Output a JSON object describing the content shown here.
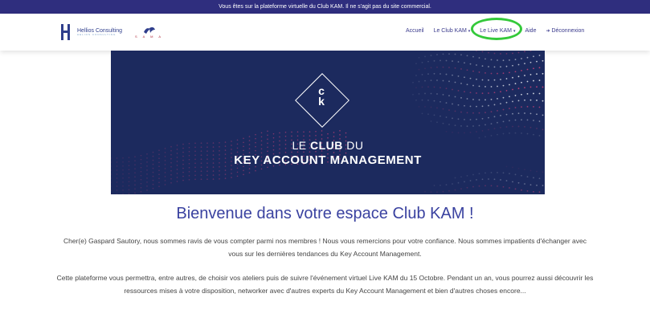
{
  "notice": "Vous êtes sur la plateforme virtuelle du Club KAM. Il ne s'agit pas du site commercial.",
  "logo": {
    "company": "Hellios Consulting",
    "company_sub": "HELIOS CONSULTING",
    "partner": "S A M A"
  },
  "nav": {
    "items": [
      {
        "label": "Accueil",
        "dropdown": false
      },
      {
        "label": "Le Club KAM",
        "dropdown": true
      },
      {
        "label": "Le Live KAM",
        "dropdown": true
      },
      {
        "label": "Aide",
        "dropdown": false
      },
      {
        "label": "Déconnexion",
        "dropdown": false,
        "icon": "logout-icon"
      }
    ],
    "caret": "▾",
    "logout_glyph": "➜",
    "highlight_color": "#34c93a"
  },
  "banner": {
    "emblem_top": "c",
    "emblem_bottom": "k",
    "line1_pre": "LE ",
    "line1_bold": "CLUB",
    "line1_post": " DU",
    "line2": "KEY ACCOUNT MANAGEMENT",
    "bg_color": "#1c2a5e",
    "accent_color": "#e0457b"
  },
  "welcome": "Bienvenue dans votre espace Club KAM !",
  "paragraphs": [
    "Cher(e) Gaspard Sautory, nous sommes ravis de vous compter parmi nos membres ! Nous vous remercions pour votre confiance. Nous sommes impatients d'échanger avec vous sur les dernières tendances du Key Account Management.",
    "Cette plateforme vous permettra, entre autres, de choisir vos ateliers puis de suivre l'événement virtuel Live KAM du 15 Octobre. Pendant un an, vous pourrez aussi découvrir les ressources mises à votre disposition, networker avec d'autres experts du Key Account Management et bien d'autres choses encore..."
  ]
}
